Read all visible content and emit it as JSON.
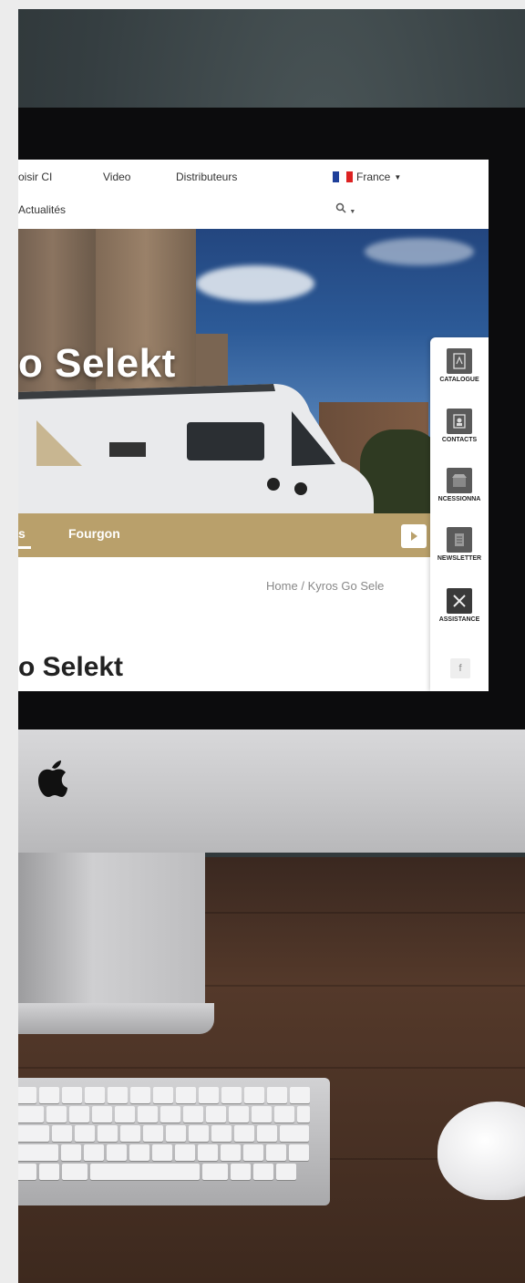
{
  "nav": {
    "items": [
      "oisir CI",
      "Video",
      "Distributeurs"
    ],
    "row2": [
      "Actualités"
    ],
    "language": "France",
    "search_icon": "search-icon"
  },
  "hero": {
    "title": "o Selekt"
  },
  "tabs": {
    "partial": "s",
    "fourgon": "Fourgon"
  },
  "breadcrumb": {
    "home": "Home",
    "separator": "/",
    "current": "Kyros Go Sele"
  },
  "page": {
    "title": "o Selekt"
  },
  "sidebar": {
    "items": [
      {
        "label": "CATALOGUE",
        "icon": "pdf-icon"
      },
      {
        "label": "CONTACTS",
        "icon": "contact-icon"
      },
      {
        "label": "NCESSIONNA",
        "icon": "store-icon"
      },
      {
        "label": "NEWSLETTER",
        "icon": "newsletter-icon"
      },
      {
        "label": "ASSISTANCE",
        "icon": "tools-icon"
      }
    ],
    "facebook": "f"
  },
  "colors": {
    "gold": "#b9a06b",
    "screen_bg": "#ffffff",
    "side_icon_bg": "#5a5a5a"
  }
}
